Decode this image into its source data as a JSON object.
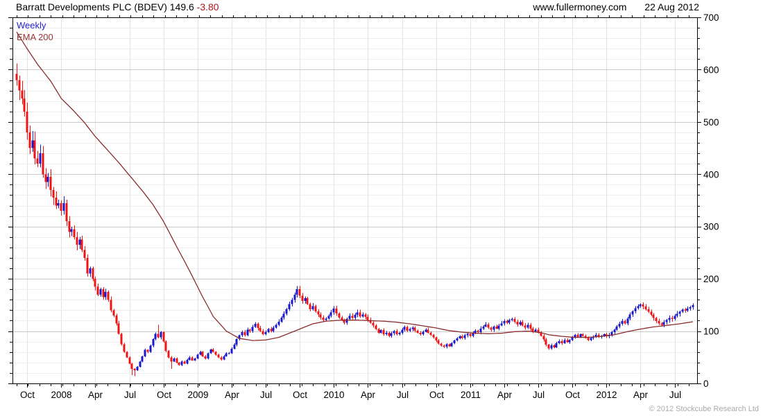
{
  "header": {
    "title": "Barratt Developments PLC (BDEV) 149.6",
    "change": "-3.80",
    "website": "www.fullermoney.com",
    "date": "22 Aug 2012"
  },
  "legend": {
    "series1": "Weekly",
    "series2": "EMA 200"
  },
  "footer": {
    "copyright": "© 2012 Stockcube Research Ltd"
  },
  "colors": {
    "up_candle": "#1818cc",
    "down_candle": "#ee1414",
    "ema_line": "#8b2c2c",
    "change_text": "#b01515",
    "legend_weekly": "#2222cc",
    "legend_ema": "#993333",
    "grid_minor": "#ededed",
    "grid_major": "#c9c9c9",
    "grid_vertical": "#e3e3e3",
    "frame": "#000000",
    "copyright_text": "#aaaaaa"
  },
  "chart_data": {
    "type": "candlestick",
    "title": "Barratt Developments PLC (BDEV) weekly candles with 200-period EMA",
    "interval": "weekly",
    "ylim": [
      0,
      700
    ],
    "y_tick_major": 100,
    "y_tick_minor": 20,
    "y_tick_labels": [
      "0",
      "100",
      "200",
      "300",
      "400",
      "500",
      "600",
      "700"
    ],
    "grid": true,
    "legend_position": "top-left",
    "x_ticks": [
      {
        "label": "Oct",
        "week": 4
      },
      {
        "label": "2008",
        "week": 17
      },
      {
        "label": "Apr",
        "week": 30
      },
      {
        "label": "Jul",
        "week": 43
      },
      {
        "label": "Oct",
        "week": 56
      },
      {
        "label": "2009",
        "week": 69
      },
      {
        "label": "Apr",
        "week": 82
      },
      {
        "label": "Jul",
        "week": 95
      },
      {
        "label": "Oct",
        "week": 108
      },
      {
        "label": "2010",
        "week": 121
      },
      {
        "label": "Apr",
        "week": 134
      },
      {
        "label": "Jul",
        "week": 147
      },
      {
        "label": "Oct",
        "week": 160
      },
      {
        "label": "2011",
        "week": 173
      },
      {
        "label": "Apr",
        "week": 186
      },
      {
        "label": "Jul",
        "week": 199
      },
      {
        "label": "Oct",
        "week": 212
      },
      {
        "label": "2012",
        "week": 225
      },
      {
        "label": "Apr",
        "week": 238
      },
      {
        "label": "Jul",
        "week": 251
      }
    ],
    "first_open": 592,
    "last_close": 149.6,
    "closes": [
      580,
      560,
      545,
      520,
      480,
      450,
      465,
      430,
      420,
      440,
      400,
      385,
      395,
      370,
      355,
      340,
      345,
      330,
      345,
      310,
      290,
      295,
      280,
      265,
      275,
      255,
      240,
      210,
      220,
      200,
      185,
      170,
      180,
      165,
      175,
      160,
      140,
      130,
      115,
      95,
      75,
      60,
      50,
      38,
      28,
      25,
      32,
      42,
      52,
      64,
      60,
      72,
      85,
      95,
      88,
      98,
      80,
      62,
      50,
      42,
      48,
      40,
      35,
      42,
      38,
      45,
      50,
      44,
      48,
      55,
      60,
      52,
      48,
      58,
      65,
      60,
      55,
      50,
      46,
      52,
      58,
      58,
      66,
      74,
      85,
      92,
      98,
      92,
      103,
      100,
      108,
      114,
      106,
      100,
      94,
      98,
      104,
      100,
      107,
      112,
      118,
      126,
      133,
      142,
      152,
      160,
      170,
      180,
      168,
      158,
      163,
      152,
      142,
      148,
      138,
      132,
      126,
      121,
      124,
      129,
      136,
      143,
      134,
      126,
      121,
      116,
      123,
      129,
      125,
      131,
      136,
      128,
      132,
      127,
      121,
      116,
      111,
      104,
      97,
      102,
      94,
      97,
      91,
      96,
      100,
      94,
      97,
      103,
      108,
      101,
      104,
      107,
      101,
      97,
      94,
      99,
      103,
      97,
      93,
      88,
      82,
      76,
      72,
      70,
      75,
      71,
      77,
      82,
      86,
      90,
      87,
      92,
      95,
      91,
      96,
      101,
      98,
      105,
      109,
      113,
      107,
      103,
      109,
      105,
      111,
      115,
      119,
      116,
      121,
      123,
      118,
      113,
      117,
      111,
      107,
      112,
      105,
      99,
      103,
      97,
      91,
      84,
      74,
      67,
      73,
      69,
      77,
      81,
      77,
      83,
      79,
      83,
      89,
      93,
      89,
      94,
      91,
      87,
      83,
      87,
      89,
      93,
      89,
      91,
      94,
      90,
      93,
      98,
      103,
      109,
      114,
      119,
      115,
      124,
      132,
      138,
      144,
      148,
      151,
      147,
      142,
      137,
      131,
      125,
      119,
      115,
      112,
      117,
      121,
      125,
      123,
      129,
      133,
      137,
      141,
      139,
      143,
      146,
      149.6
    ],
    "wick_overrides": {
      "44": {
        "low": 16
      },
      "45": {
        "low": 14
      },
      "54": {
        "high": 112
      },
      "59": {
        "low": 28
      },
      "107": {
        "high": 186
      },
      "121": {
        "high": 148
      },
      "189": {
        "high": 126
      },
      "238": {
        "high": 153
      },
      "258": {
        "high": 153
      }
    },
    "ema_label": "EMA 200",
    "ema_points": [
      [
        0,
        672
      ],
      [
        4,
        640
      ],
      [
        8,
        610
      ],
      [
        13,
        578
      ],
      [
        17,
        545
      ],
      [
        22,
        520
      ],
      [
        26,
        498
      ],
      [
        30,
        472
      ],
      [
        34,
        450
      ],
      [
        39,
        422
      ],
      [
        43,
        398
      ],
      [
        48,
        368
      ],
      [
        52,
        342
      ],
      [
        56,
        310
      ],
      [
        61,
        262
      ],
      [
        66,
        215
      ],
      [
        71,
        165
      ],
      [
        75,
        128
      ],
      [
        80,
        100
      ],
      [
        85,
        86
      ],
      [
        90,
        82
      ],
      [
        95,
        83
      ],
      [
        100,
        88
      ],
      [
        105,
        98
      ],
      [
        110,
        108
      ],
      [
        113,
        114
      ],
      [
        118,
        119
      ],
      [
        124,
        121
      ],
      [
        130,
        121
      ],
      [
        135,
        120
      ],
      [
        140,
        119
      ],
      [
        145,
        117
      ],
      [
        150,
        114
      ],
      [
        155,
        110
      ],
      [
        160,
        106
      ],
      [
        165,
        101
      ],
      [
        170,
        98
      ],
      [
        175,
        96
      ],
      [
        180,
        95
      ],
      [
        185,
        96
      ],
      [
        190,
        99
      ],
      [
        195,
        100
      ],
      [
        200,
        97
      ],
      [
        203,
        93
      ],
      [
        208,
        90
      ],
      [
        213,
        88
      ],
      [
        218,
        88
      ],
      [
        223,
        90
      ],
      [
        228,
        93
      ],
      [
        233,
        99
      ],
      [
        238,
        104
      ],
      [
        243,
        108
      ],
      [
        248,
        111
      ],
      [
        253,
        114
      ],
      [
        258,
        118
      ]
    ]
  }
}
